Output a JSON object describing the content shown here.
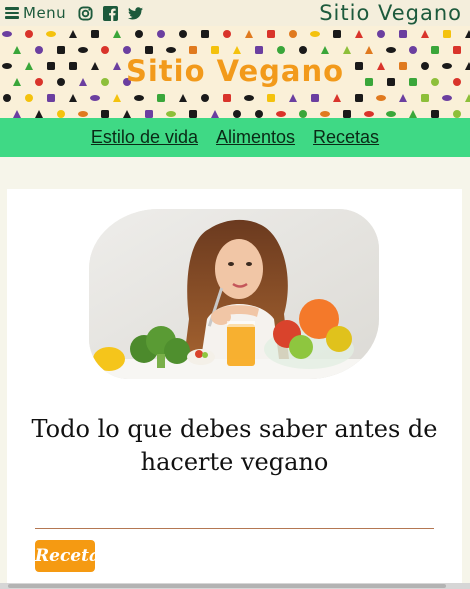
{
  "topbar": {
    "menu_label": "Menu",
    "site_name": "Sitio Vegano",
    "social": [
      "instagram-icon",
      "facebook-icon",
      "twitter-icon"
    ]
  },
  "banner": {
    "title": "Sitio Vegano"
  },
  "nav": {
    "items": [
      "Estilo de vida",
      "Alimentos",
      "Recetas"
    ]
  },
  "article": {
    "title": "Todo lo que debes saber antes de hacerte vegano",
    "category": "Receta:"
  },
  "colors": {
    "brand_green": "#3fd985",
    "brand_dark_green": "#1d5a3c",
    "brand_orange": "#f29a1b",
    "badge_orange": "#f59a12",
    "divider_brown": "#b47752"
  }
}
